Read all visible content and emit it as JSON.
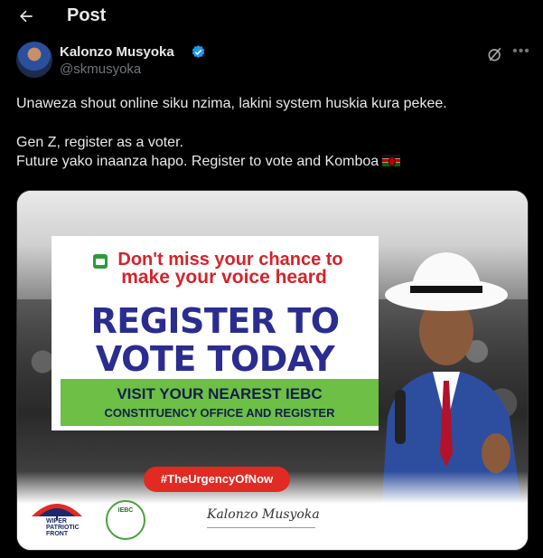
{
  "header": {
    "title": "Post"
  },
  "author": {
    "name": "Kalonzo Musyoka",
    "handle": "@skmusyoka"
  },
  "post": {
    "line1": "Unaweza shout online siku nzima, lakini system huskia kura pekee.",
    "line2": "Gen Z, register as a voter.",
    "line3": "Future yako inaanza hapo. Register to vote and Komboa",
    "flag_icon": "kenya-flag-icon"
  },
  "media": {
    "tagline_1": "Don't miss your chance to",
    "tagline_2": "make your voice heard",
    "headline_1": "REGISTER TO",
    "headline_2": "VOTE TODAY",
    "cta_1": "VISIT YOUR NEAREST IEBC",
    "cta_2": "CONSTITUENCY OFFICE AND REGISTER",
    "hashtag": "#TheUrgencyOfNow",
    "wiper_logo_text_1": "WIPER",
    "wiper_logo_text_2": "PATRIOTIC",
    "wiper_logo_text_3": "FRONT",
    "iebc_logo_text": "IEBC",
    "signature": "Kalonzo Musyoka"
  },
  "icons": {
    "back": "arrow-left-icon",
    "verified": "verified-badge-icon",
    "grok": "grok-icon",
    "more": "more-dots-icon"
  },
  "colors": {
    "background": "#000000",
    "text": "#e7e9ea",
    "muted": "#71767b",
    "verified": "#1d9bf0",
    "poster_red": "#d6232a",
    "poster_blue": "#2a2d8f",
    "poster_green": "#6dbf45"
  }
}
